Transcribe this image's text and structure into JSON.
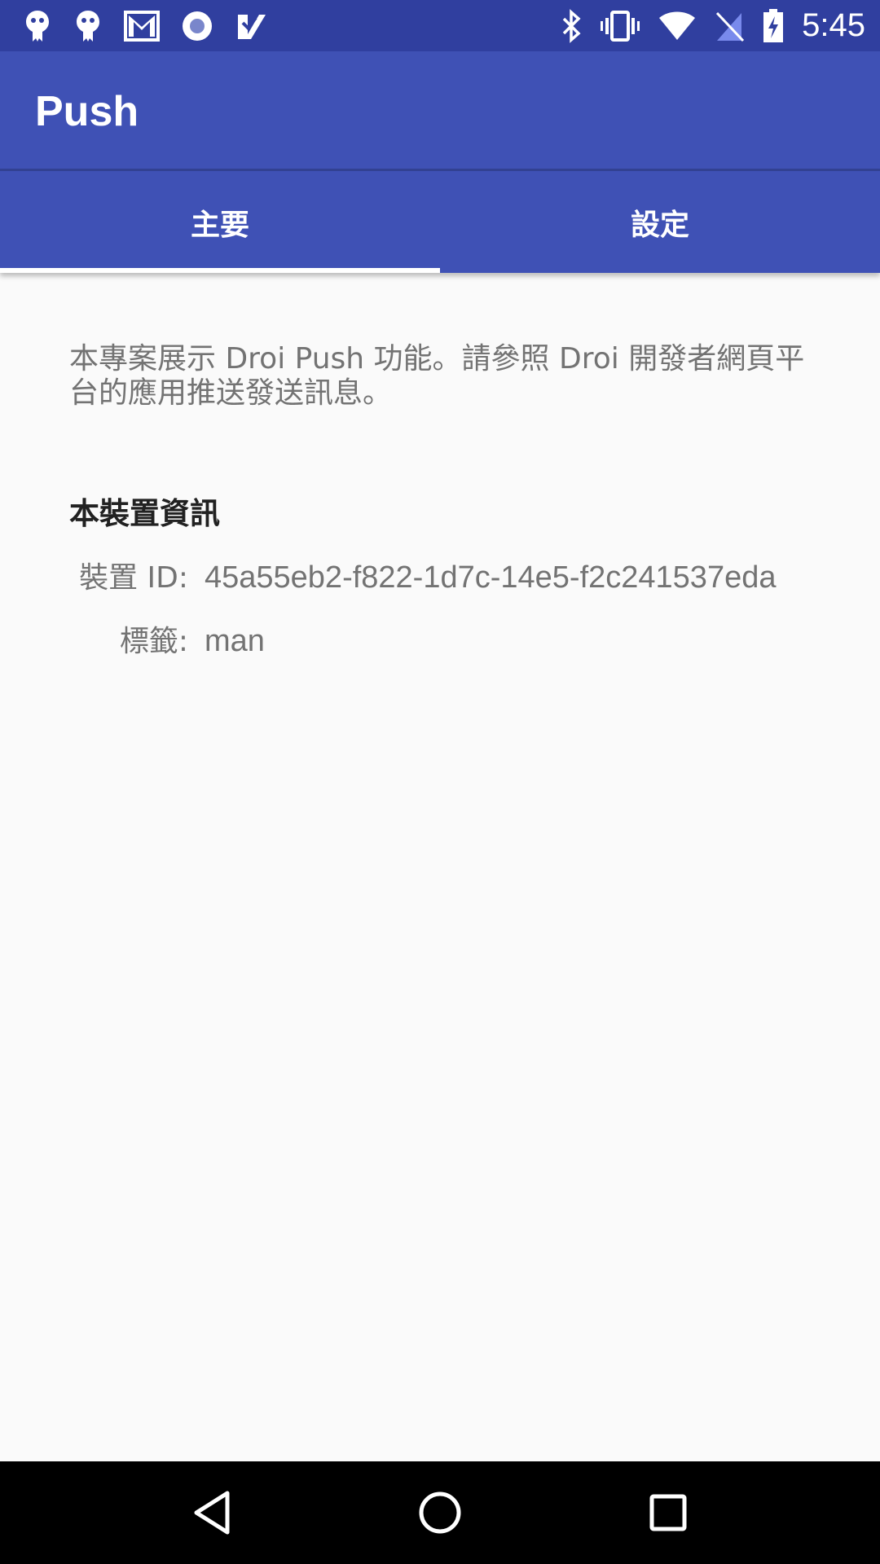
{
  "status_bar": {
    "time": "5:45",
    "left_icons": [
      "app-notification-icon",
      "app-notification-icon",
      "gmail-icon",
      "record-icon",
      "task-check-icon"
    ],
    "right_icons": [
      "bluetooth-icon",
      "vibrate-icon",
      "wifi-icon",
      "no-sim-icon",
      "battery-charging-icon"
    ]
  },
  "app_bar": {
    "title": "Push"
  },
  "tabs": [
    {
      "label": "主要",
      "selected": true
    },
    {
      "label": "設定",
      "selected": false
    }
  ],
  "main": {
    "intro": "本專案展示 Droi Push 功能。請參照 Droi 開發者網頁平台的應用推送發送訊息。",
    "section_title": "本裝置資訊",
    "device_id_label": "裝置 ID:",
    "device_id_value": "45a55eb2-f822-1d7c-14e5-f2c241537eda",
    "tag_label": "標籤:",
    "tag_value": "man"
  },
  "nav_bar": {
    "buttons": [
      "back-icon",
      "home-icon",
      "recents-icon"
    ]
  },
  "colors": {
    "primary": "#3f51b5",
    "primary_dark": "#303f9f",
    "background": "#fafafa"
  }
}
